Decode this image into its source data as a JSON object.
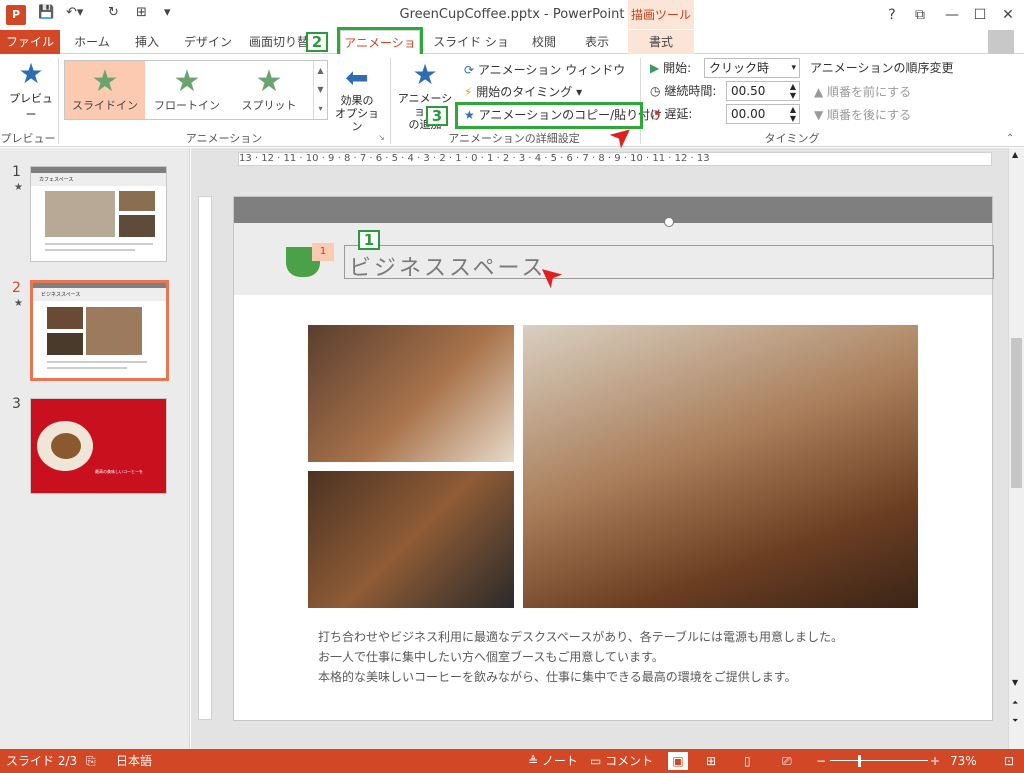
{
  "window": {
    "title": "GreenCupCoffee.pptx - PowerPoint",
    "context_group": "描画ツール",
    "help": "?",
    "min": "—",
    "max": "☐",
    "close": "✕"
  },
  "tabs": {
    "file": "ファイル",
    "home": "ホーム",
    "insert": "挿入",
    "design": "デザイン",
    "transitions": "画面切り替",
    "animations": "アニメーション",
    "slideshow": "スライド ショー",
    "review": "校閲",
    "view": "表示",
    "format": "書式"
  },
  "ribbon": {
    "preview": "プレビュー",
    "preview_group": "プレビュー",
    "gallery": [
      "スライドイン",
      "フロートイン",
      "スプリット"
    ],
    "animation_group": "アニメーション",
    "effect_options": "効果の\nオプション",
    "add_animation": "アニメーション\nの追加",
    "animation_pane": "アニメーション ウィンドウ",
    "trigger": "開始のタイミング",
    "animation_painter": "アニメーションのコピー/貼り付け",
    "advanced_group": "アニメーションの詳細設定",
    "start_label": "開始:",
    "start_value": "クリック時",
    "duration_label": "継続時間:",
    "duration_value": "00.50",
    "delay_label": "遅延:",
    "delay_value": "00.00",
    "timing_group": "タイミング",
    "reorder_title": "アニメーションの順序変更",
    "move_earlier": "順番を前にする",
    "move_later": "順番を後にする"
  },
  "thumbnails": [
    {
      "num": "1",
      "star": "★",
      "title": "カフェスペース"
    },
    {
      "num": "2",
      "star": "★",
      "title": "ビジネススペース"
    },
    {
      "num": "3",
      "star": "",
      "title": "最高の美味しいコーヒーを"
    }
  ],
  "ruler_h": "13 · 12 · 11 · 10 · 9 · 8 · 7 · 6 · 5 · 4 · 3 · 2 · 1 · 0 · 1 · 2 · 3 · 4 · 5 · 6 · 7 · 8 · 9 · 10 · 11 · 12 · 13",
  "slide": {
    "title": "ビジネススペース",
    "anim_tag": "1",
    "body_lines": [
      "打ち合わせやビジネス利用に最適なデスクスペースがあり、各テーブルには電源も用意しました。",
      "お一人で仕事に集中したい方へ個室ブースもご用意しています。",
      "本格的な美味しいコーヒーを飲みながら、仕事に集中できる最高の環境をご提供します。"
    ]
  },
  "callouts": [
    "1",
    "2",
    "3"
  ],
  "status": {
    "slide": "スライド 2/3",
    "language": "日本語",
    "notes": "ノート",
    "comments": "コメント",
    "zoom": "73%"
  },
  "colors": {
    "accent": "#d24726",
    "callout": "#2ea836",
    "arrow": "#e01f1f",
    "slide_header": "#7f7f7f",
    "title_band": "#ececec",
    "cup": "#4aa147"
  }
}
